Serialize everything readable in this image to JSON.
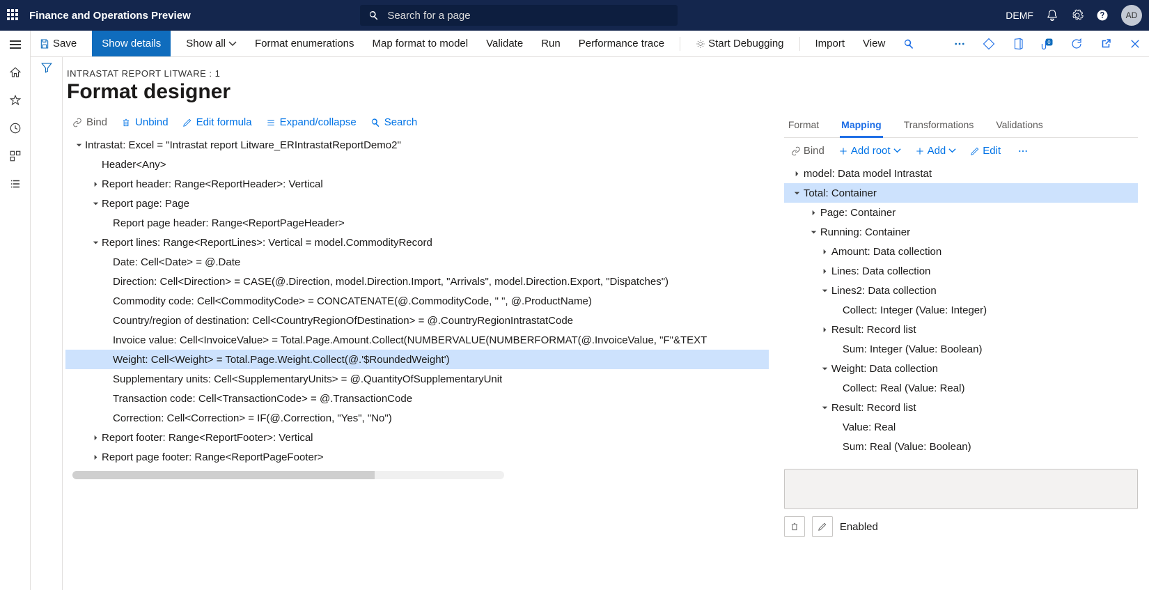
{
  "nav": {
    "app_title": "Finance and Operations Preview",
    "search_placeholder": "Search for a page",
    "company": "DEMF",
    "avatar": "AD"
  },
  "toolbar": {
    "save": "Save",
    "show_details": "Show details",
    "show_all": "Show all",
    "format_enum": "Format enumerations",
    "map_format": "Map format to model",
    "validate": "Validate",
    "run": "Run",
    "perf": "Performance trace",
    "start_debug": "Start Debugging",
    "import": "Import",
    "view": "View"
  },
  "page": {
    "breadcrumb": "INTRASTAT REPORT LITWARE : 1",
    "title": "Format designer"
  },
  "left_actions": {
    "bind": "Bind",
    "unbind": "Unbind",
    "edit_formula": "Edit formula",
    "expand": "Expand/collapse",
    "search": "Search"
  },
  "left_tree": [
    {
      "depth": 0,
      "chevron": "down",
      "text": "Intrastat: Excel = \"Intrastat report Litware_ERIntrastatReportDemo2\""
    },
    {
      "depth": 1,
      "chevron": "none",
      "text": "Header<Any>"
    },
    {
      "depth": 1,
      "chevron": "right",
      "text": "Report header: Range<ReportHeader>: Vertical"
    },
    {
      "depth": 1,
      "chevron": "down",
      "text": "Report page: Page"
    },
    {
      "depth": 2,
      "chevron": "none",
      "text": "Report page header: Range<ReportPageHeader>"
    },
    {
      "depth": 1,
      "chevron": "down",
      "text": "Report lines: Range<ReportLines>: Vertical = model.CommodityRecord"
    },
    {
      "depth": 2,
      "chevron": "none",
      "text": "Date: Cell<Date> = @.Date"
    },
    {
      "depth": 2,
      "chevron": "none",
      "text": "Direction: Cell<Direction> = CASE(@.Direction, model.Direction.Import, \"Arrivals\", model.Direction.Export, \"Dispatches\")"
    },
    {
      "depth": 2,
      "chevron": "none",
      "text": "Commodity code: Cell<CommodityCode> = CONCATENATE(@.CommodityCode, \" \", @.ProductName)"
    },
    {
      "depth": 2,
      "chevron": "none",
      "text": "Country/region of destination: Cell<CountryRegionOfDestination> = @.CountryRegionIntrastatCode"
    },
    {
      "depth": 2,
      "chevron": "none",
      "text": "Invoice value: Cell<InvoiceValue> = Total.Page.Amount.Collect(NUMBERVALUE(NUMBERFORMAT(@.InvoiceValue, \"F\"&TEXT"
    },
    {
      "depth": 2,
      "chevron": "none",
      "text": "Weight: Cell<Weight> = Total.Page.Weight.Collect(@.'$RoundedWeight')",
      "selected": true
    },
    {
      "depth": 2,
      "chevron": "none",
      "text": "Supplementary units: Cell<SupplementaryUnits> = @.QuantityOfSupplementaryUnit"
    },
    {
      "depth": 2,
      "chevron": "none",
      "text": "Transaction code: Cell<TransactionCode> = @.TransactionCode"
    },
    {
      "depth": 2,
      "chevron": "none",
      "text": "Correction: Cell<Correction> = IF(@.Correction, \"Yes\", \"No\")"
    },
    {
      "depth": 1,
      "chevron": "right",
      "text": "Report footer: Range<ReportFooter>: Vertical"
    },
    {
      "depth": 1,
      "chevron": "right",
      "text": "Report page footer: Range<ReportPageFooter>"
    }
  ],
  "right_tabs": {
    "format": "Format",
    "mapping": "Mapping",
    "transformations": "Transformations",
    "validations": "Validations"
  },
  "right_actions": {
    "bind": "Bind",
    "add_root": "Add root",
    "add": "Add",
    "edit": "Edit"
  },
  "right_tree": [
    {
      "depth": 0,
      "chevron": "right",
      "text": "model: Data model Intrastat"
    },
    {
      "depth": 0,
      "chevron": "down",
      "text": "Total: Container",
      "selected": true
    },
    {
      "depth": 1,
      "chevron": "right",
      "text": "Page: Container"
    },
    {
      "depth": 1,
      "chevron": "down",
      "text": "Running: Container"
    },
    {
      "depth": 2,
      "chevron": "right",
      "text": "Amount: Data collection"
    },
    {
      "depth": 2,
      "chevron": "right",
      "text": "Lines: Data collection"
    },
    {
      "depth": 2,
      "chevron": "down",
      "text": "Lines2: Data collection"
    },
    {
      "depth": 3,
      "chevron": "none",
      "text": "Collect: Integer (Value: Integer)"
    },
    {
      "depth": 2,
      "chevron": "right",
      "text": "Result: Record list"
    },
    {
      "depth": 3,
      "chevron": "none",
      "text": "Sum: Integer (Value: Boolean)"
    },
    {
      "depth": 2,
      "chevron": "down",
      "text": "Weight: Data collection"
    },
    {
      "depth": 3,
      "chevron": "none",
      "text": "Collect: Real (Value: Real)"
    },
    {
      "depth": 2,
      "chevron": "down",
      "text": "Result: Record list"
    },
    {
      "depth": 3,
      "chevron": "none",
      "text": "Value: Real"
    },
    {
      "depth": 3,
      "chevron": "none",
      "text": "Sum: Real (Value: Boolean)"
    }
  ],
  "enabled_label": "Enabled"
}
